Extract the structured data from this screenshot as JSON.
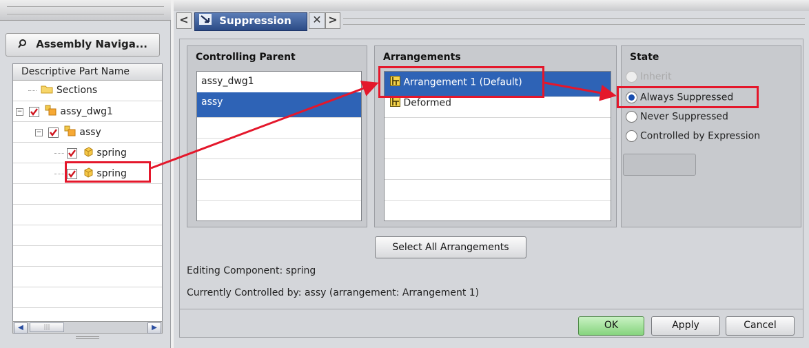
{
  "navigator": {
    "title": "Assembly Naviga...",
    "column_header": "Descriptive Part Name",
    "nodes": [
      {
        "label": "Sections"
      },
      {
        "label": "assy_dwg1"
      },
      {
        "label": "assy"
      },
      {
        "label": "spring"
      },
      {
        "label": "spring"
      }
    ]
  },
  "tab": {
    "title": "Suppression",
    "prev": "<",
    "next": ">",
    "close": "✕"
  },
  "controlling_parent": {
    "title": "Controlling Parent",
    "items": [
      "assy_dwg1",
      "assy"
    ],
    "selected_index": 1
  },
  "arrangements": {
    "title": "Arrangements",
    "items": [
      "Arrangement 1 (Default)",
      "Deformed"
    ],
    "selected_index": 0,
    "select_all_label": "Select All Arrangements"
  },
  "state": {
    "title": "State",
    "options": [
      "Inherit",
      "Always Suppressed",
      "Never Suppressed",
      "Controlled by Expression"
    ],
    "selected_index": 1,
    "disabled_index": 0
  },
  "info": {
    "editing": "Editing Component: spring",
    "controlled_by": "Currently Controlled by: assy (arrangement: Arrangement 1)"
  },
  "buttons": {
    "ok": "OK",
    "apply": "Apply",
    "cancel": "Cancel"
  },
  "colors": {
    "selection": "#2e63b6",
    "highlight": "#e4172b",
    "ok_button": "#86d47e"
  }
}
